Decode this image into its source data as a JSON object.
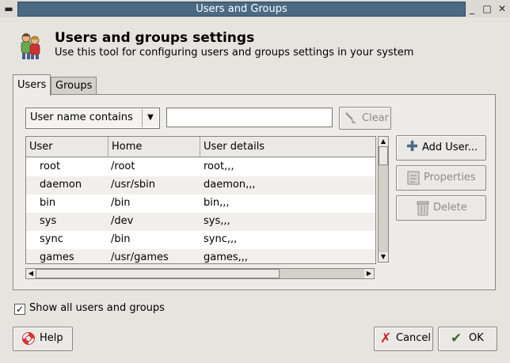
{
  "window": {
    "title": "Users and Groups"
  },
  "header": {
    "title": "Users and groups settings",
    "subtitle": "Use this tool for configuring users and groups settings in your system"
  },
  "tabs": [
    {
      "label": "Users"
    },
    {
      "label": "Groups"
    }
  ],
  "filter": {
    "selected": "User name contains",
    "search_value": "",
    "clear_label": "Clear"
  },
  "table": {
    "columns": [
      "User",
      "Home",
      "User details"
    ],
    "rows": [
      {
        "user": "root",
        "home": "/root",
        "details": "root,,,"
      },
      {
        "user": "daemon",
        "home": "/usr/sbin",
        "details": "daemon,,,"
      },
      {
        "user": "bin",
        "home": "/bin",
        "details": "bin,,,"
      },
      {
        "user": "sys",
        "home": "/dev",
        "details": "sys,,,"
      },
      {
        "user": "sync",
        "home": "/bin",
        "details": "sync,,,"
      },
      {
        "user": "games",
        "home": "/usr/games",
        "details": "games,,,"
      }
    ]
  },
  "side_buttons": {
    "add_user": "Add User...",
    "properties": "Properties",
    "delete": "Delete"
  },
  "options": {
    "show_all_label": "Show all users and groups",
    "show_all_checked": true
  },
  "footer": {
    "help": "Help",
    "cancel": "Cancel",
    "ok": "OK"
  },
  "colors": {
    "titlebar": "#4b6983",
    "window_bg": "#e6e4df"
  }
}
